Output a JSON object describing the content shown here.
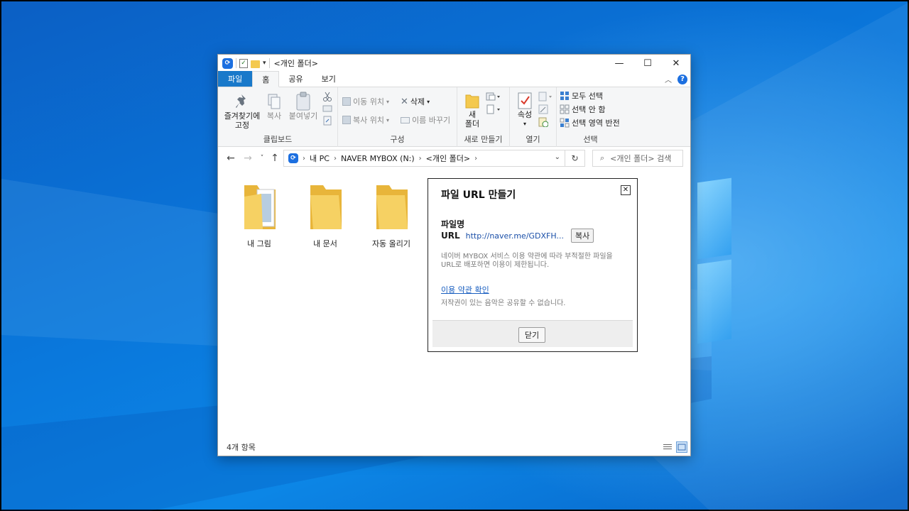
{
  "window": {
    "title": "<개인 폴더>",
    "minimize": "—",
    "maximize": "☐",
    "close": "✕"
  },
  "tabs": [
    {
      "label": "파일"
    },
    {
      "label": "홈"
    },
    {
      "label": "공유"
    },
    {
      "label": "보기"
    }
  ],
  "ribbon": {
    "clipboard": {
      "pin_label_1": "즐겨찾기에",
      "pin_label_2": "고정",
      "copy_label": "복사",
      "paste_label": "붙여넣기",
      "group_label": "클립보드"
    },
    "organize": {
      "move_to": "이동 위치",
      "copy_to": "복사 위치",
      "delete": "삭제",
      "rename": "이름 바꾸기",
      "group_label": "구성"
    },
    "new": {
      "new_folder_1": "새",
      "new_folder_2": "폴더",
      "group_label": "새로 만들기"
    },
    "open": {
      "properties": "속성",
      "group_label": "열기"
    },
    "select": {
      "select_all": "모두 선택",
      "select_none": "선택 안 함",
      "invert": "선택 영역 반전",
      "group_label": "선택"
    }
  },
  "address": {
    "crumbs": [
      "내 PC",
      "NAVER MYBOX (N:)",
      "<개인 폴더>"
    ],
    "search_placeholder": "<개인 폴더> 검색"
  },
  "folders": [
    {
      "label": "내 그림"
    },
    {
      "label": "내 문서"
    },
    {
      "label": "자동 올리기"
    }
  ],
  "status": {
    "item_count": "4개 항목"
  },
  "dialog": {
    "title": "파일 URL 만들기",
    "filename_label": "파일명",
    "url_label": "URL",
    "url_value": "http://naver.me/GDXFH...",
    "copy_button": "복사",
    "notice": "네이버 MYBOX 서비스 이용 약관에 따라 부적절한 파일을 URL로 배포하면 이용이 제한됩니다.",
    "terms_link": "이용 약관 확인",
    "copyright_note": "저작권이 있는 음악은 공유할 수 없습니다.",
    "close_button": "닫기"
  },
  "colors": {
    "accent": "#1979ca",
    "desktop": "#0a78dc",
    "folder": "#f4c94f",
    "link": "#1a5fc0"
  }
}
